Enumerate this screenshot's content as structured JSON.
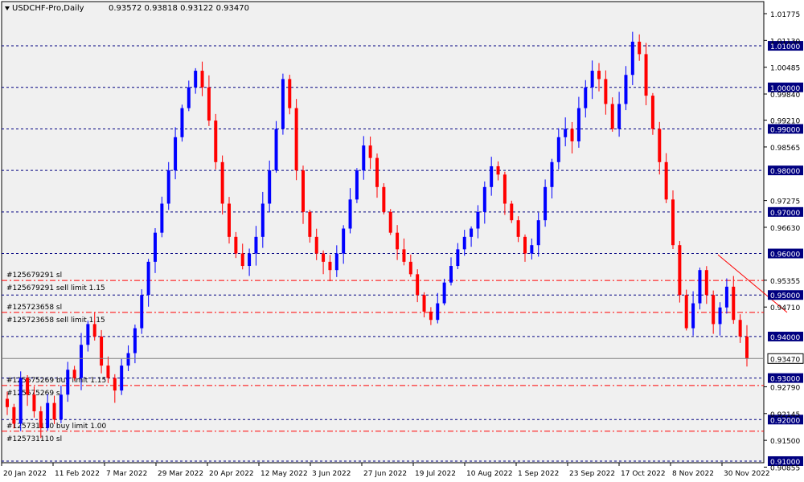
{
  "header": {
    "symbol": "USDCHF-Pro,Daily",
    "ohlc": "0.93572 0.93818 0.93122 0.93470"
  },
  "colors": {
    "background": "#FFFFFF",
    "plot_background": "#F0F0F0",
    "bull": "#0000FF",
    "bear": "#FF0000",
    "grid_level": "#000080",
    "order_line": "#FF0000",
    "price_label_bg": "#000080",
    "current_price_bg": "#FFFFFF"
  },
  "chart_data": {
    "type": "candlestick",
    "symbol": "USDCHF",
    "timeframe": "Daily",
    "y_range": [
      0.90855,
      1.01775
    ],
    "y_tick_labels": [
      "1.01775",
      "1.01130",
      "1.00485",
      "0.99840",
      "0.99210",
      "0.98565",
      "0.97275",
      "0.96630",
      "0.95355",
      "0.94710",
      "0.92790",
      "0.92145",
      "0.91500",
      "0.90855"
    ],
    "x_tick_labels": [
      "20 Jan 2022",
      "11 Feb 2022",
      "7 Mar 2022",
      "29 Mar 2022",
      "20 Apr 2022",
      "12 May 2022",
      "3 Jun 2022",
      "27 Jun 2022",
      "19 Jul 2022",
      "10 Aug 2022",
      "1 Sep 2022",
      "23 Sep 2022",
      "17 Oct 2022",
      "8 Nov 2022",
      "30 Nov 2022"
    ],
    "current_price": "0.93470",
    "levels": [
      "1.01000",
      "1.00000",
      "0.99000",
      "0.98000",
      "0.97000",
      "0.96000",
      "0.95000",
      "0.94000",
      "0.93000",
      "0.92000",
      "0.91000"
    ],
    "order_lines": [
      {
        "label": "#125679291 sl",
        "price": 0.9535
      },
      {
        "label": "#125679291 sell limit 1.15",
        "price": 0.9535
      },
      {
        "label": "#125723658 sl",
        "price": 0.9458
      },
      {
        "label": "#125723658 sell limit 1.15",
        "price": 0.9458
      },
      {
        "label": "#125675269 buy limit 1.15",
        "price": 0.9282
      },
      {
        "label": "#125675269 sl",
        "price": 0.9282
      },
      {
        "label": "#125731110 buy limit 1.00",
        "price": 0.9172
      },
      {
        "label": "#125731110 sl",
        "price": 0.9172
      }
    ],
    "trendline": {
      "from": [
        0.9597,
        "8 Nov 2022"
      ],
      "to": [
        0.9458,
        "30 Nov 2022"
      ]
    },
    "close_path": [
      0.923,
      0.919,
      0.93,
      0.926,
      0.922,
      0.918,
      0.924,
      0.92,
      0.926,
      0.932,
      0.93,
      0.938,
      0.943,
      0.94,
      0.933,
      0.93,
      0.927,
      0.933,
      0.936,
      0.942,
      0.95,
      0.958,
      0.965,
      0.972,
      0.98,
      0.988,
      0.995,
      1.0,
      1.004,
      1.0,
      0.992,
      0.982,
      0.972,
      0.964,
      0.96,
      0.957,
      0.96,
      0.964,
      0.972,
      0.98,
      0.99,
      1.002,
      0.995,
      0.98,
      0.97,
      0.964,
      0.96,
      0.958,
      0.956,
      0.96,
      0.966,
      0.973,
      0.98,
      0.986,
      0.983,
      0.976,
      0.97,
      0.965,
      0.961,
      0.958,
      0.955,
      0.95,
      0.946,
      0.944,
      0.948,
      0.953,
      0.957,
      0.961,
      0.964,
      0.966,
      0.97,
      0.976,
      0.981,
      0.979,
      0.972,
      0.968,
      0.964,
      0.96,
      0.962,
      0.968,
      0.976,
      0.982,
      0.988,
      0.99,
      0.987,
      0.995,
      1.0,
      1.004,
      1.002,
      0.996,
      0.99,
      0.996,
      1.003,
      1.011,
      1.008,
      0.998,
      0.99,
      0.982,
      0.973,
      0.962,
      0.95,
      0.942,
      0.948,
      0.956,
      0.95,
      0.943,
      0.947,
      0.952,
      0.944,
      0.94,
      0.9347
    ]
  }
}
